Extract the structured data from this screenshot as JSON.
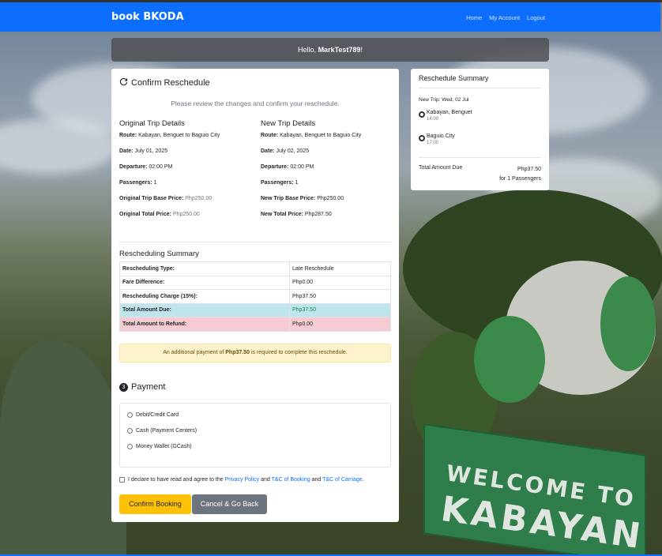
{
  "navbar": {
    "brand": "book BKODA",
    "links": [
      "Home",
      "My Account",
      "Logout"
    ]
  },
  "greeting": {
    "prefix": "Hello, ",
    "username": "MarkTest789",
    "suffix": "!"
  },
  "main": {
    "title": "Confirm Reschedule",
    "subtitle": "Please review the changes and confirm your reschedule.",
    "original": {
      "heading": "Original Trip Details",
      "rows": [
        {
          "label": "Route:",
          "value": "Kabayan, Benguet to Baguio City",
          "muted": false
        },
        {
          "label": "Date:",
          "value": "July 01, 2025",
          "muted": false
        },
        {
          "label": "Departure:",
          "value": "02:00 PM",
          "muted": false
        },
        {
          "label": "Passengers:",
          "value": "1",
          "muted": false
        },
        {
          "label": "Original Trip Base Price:",
          "value": "Php250.00",
          "muted": true
        },
        {
          "label": "Original Total Price:",
          "value": "Php250.00",
          "muted": true
        }
      ]
    },
    "new": {
      "heading": "New Trip Details",
      "rows": [
        {
          "label": "Route:",
          "value": "Kabayan, Benguet to Baguio City",
          "muted": false
        },
        {
          "label": "Date:",
          "value": "July 02, 2025",
          "muted": false
        },
        {
          "label": "Departure:",
          "value": "02:00 PM",
          "muted": false
        },
        {
          "label": "Passengers:",
          "value": "1",
          "muted": false
        },
        {
          "label": "New Trip Base Price:",
          "value": "Php250.00",
          "muted": false
        },
        {
          "label": "New Total Price:",
          "value": "Php287.50",
          "muted": false
        }
      ]
    },
    "rescheduling_summary": {
      "heading": "Rescheduling Summary",
      "rows": [
        {
          "label": "Rescheduling Type:",
          "value": "Late Reschedule"
        },
        {
          "label": "Fare Difference:",
          "value": "Php0.00"
        },
        {
          "label": "Rescheduling Charge (15%):",
          "value": "Php37.50"
        },
        {
          "label": "Total Amount Due:",
          "value": "Php37.50"
        },
        {
          "label": "Total Amount to Refund:",
          "value": "Php0.00"
        }
      ]
    },
    "alert": {
      "prefix": "An additional payment of ",
      "amount": "Php37.50",
      "suffix": " is required to complete this reschedule."
    },
    "payment": {
      "step": "3",
      "heading": "Payment",
      "options": [
        "Debit/Credit Card",
        "Cash (Payment Centers)",
        "Money Wallet (GCash)"
      ]
    },
    "agreement": {
      "text1": "I declare to have read and agree to the ",
      "link1": "Privacy Policy",
      "text2": " and ",
      "link2": "T&C of Booking",
      "text3": " and ",
      "link3": "T&C of Carriage",
      "text4": "."
    },
    "buttons": {
      "confirm": "Confirm Booking",
      "back": "Cancel & Go Back"
    }
  },
  "summary": {
    "title": "Reschedule Summary",
    "new_trip": "New Trip: Wed, 02 Jul",
    "origin": {
      "name": "Kabayan, Benguet",
      "time": "14:00"
    },
    "destination": {
      "name": "Baguio City",
      "time": "17:00"
    },
    "total_label": "Total Amount Due",
    "total_amount": "Php37.50",
    "passengers_note": "for 1 Passengers"
  },
  "background_sign": {
    "line1": "WELCOME TO",
    "line2": "KABAYAN"
  },
  "colors": {
    "navbar": "#0d6efd",
    "confirm_button": "#ffc107",
    "back_button": "#6c757d",
    "due_row": "#bee5ec",
    "refund_row": "#f6cbd2",
    "alert_bg": "#fff3cd"
  }
}
